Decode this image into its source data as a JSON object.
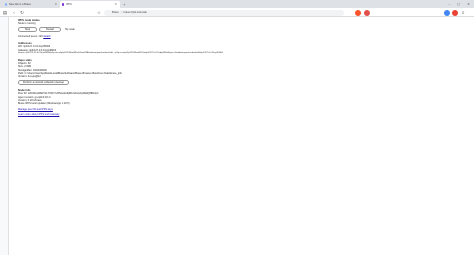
{
  "tabs": [
    {
      "label": "New tab in a Brave",
      "active": false
    },
    {
      "label": "IPFS",
      "active": true
    }
  ],
  "toolbar": {
    "omnibox_prefix": "Brave",
    "omnibox_url": "brave://ipfs-internals"
  },
  "node_status": {
    "heading": "IPFS node status",
    "status_text": "Node is running",
    "stop_label": "Stop",
    "restart_label": "Restart",
    "my_node_label": "My node",
    "peers_text": "Connected peers: 129",
    "peers_link": "details"
  },
  "addresses": {
    "heading": "Addresses",
    "api": "API: /ip4/127.0.0.1/tcp/45004",
    "gateway": "Gateway: /ip4/127.0.0.1/tcp/48004",
    "swarm": "Swarm: /ip4/172.20.10.2/tcp/44004/p2p-circuit/p2p/12D3KooWFw5ZezoD8B/webtransport/certhash/uEi…/p2p-circuit/p2p/12D3KooWCXmi/ip4/127.0.0.1/udp/44004/quic-v1/webtransport/certhash/uEi/ip4/127.0.0.1/tcp/44004"
  },
  "repo": {
    "heading": "Repo stats",
    "objects": "Objects: 52",
    "size": "Size: 2.9Mb",
    "storage_max": "StorageMax: 1000000000",
    "path": "Path: C:\\Users\\User\\AppData\\Local\\BraveSoftware\\Brave-Browser-Beta\\User Data\\brave_ipfs",
    "version": "Version: fs-repo@12",
    "gc_label": "Perform a network collection cleanup"
  },
  "node_info": {
    "heading": "Node info",
    "peer_id": "Peer ID: 12D3KooWEf7sKJYbPcYvDNxwttoZjDFuVAxwJp4FEiQ58N4yC",
    "agent": "Agent version: go-ipfs/0.18.1/",
    "version": "Version: 0.18.1/brave",
    "brave_version": "Brave IPFS local updater (Windows/go 1.19.5)"
  },
  "links": {
    "manage": "Manage peer ID and IPFS keys",
    "learn": "Learn more about IPFS and Gateway"
  }
}
